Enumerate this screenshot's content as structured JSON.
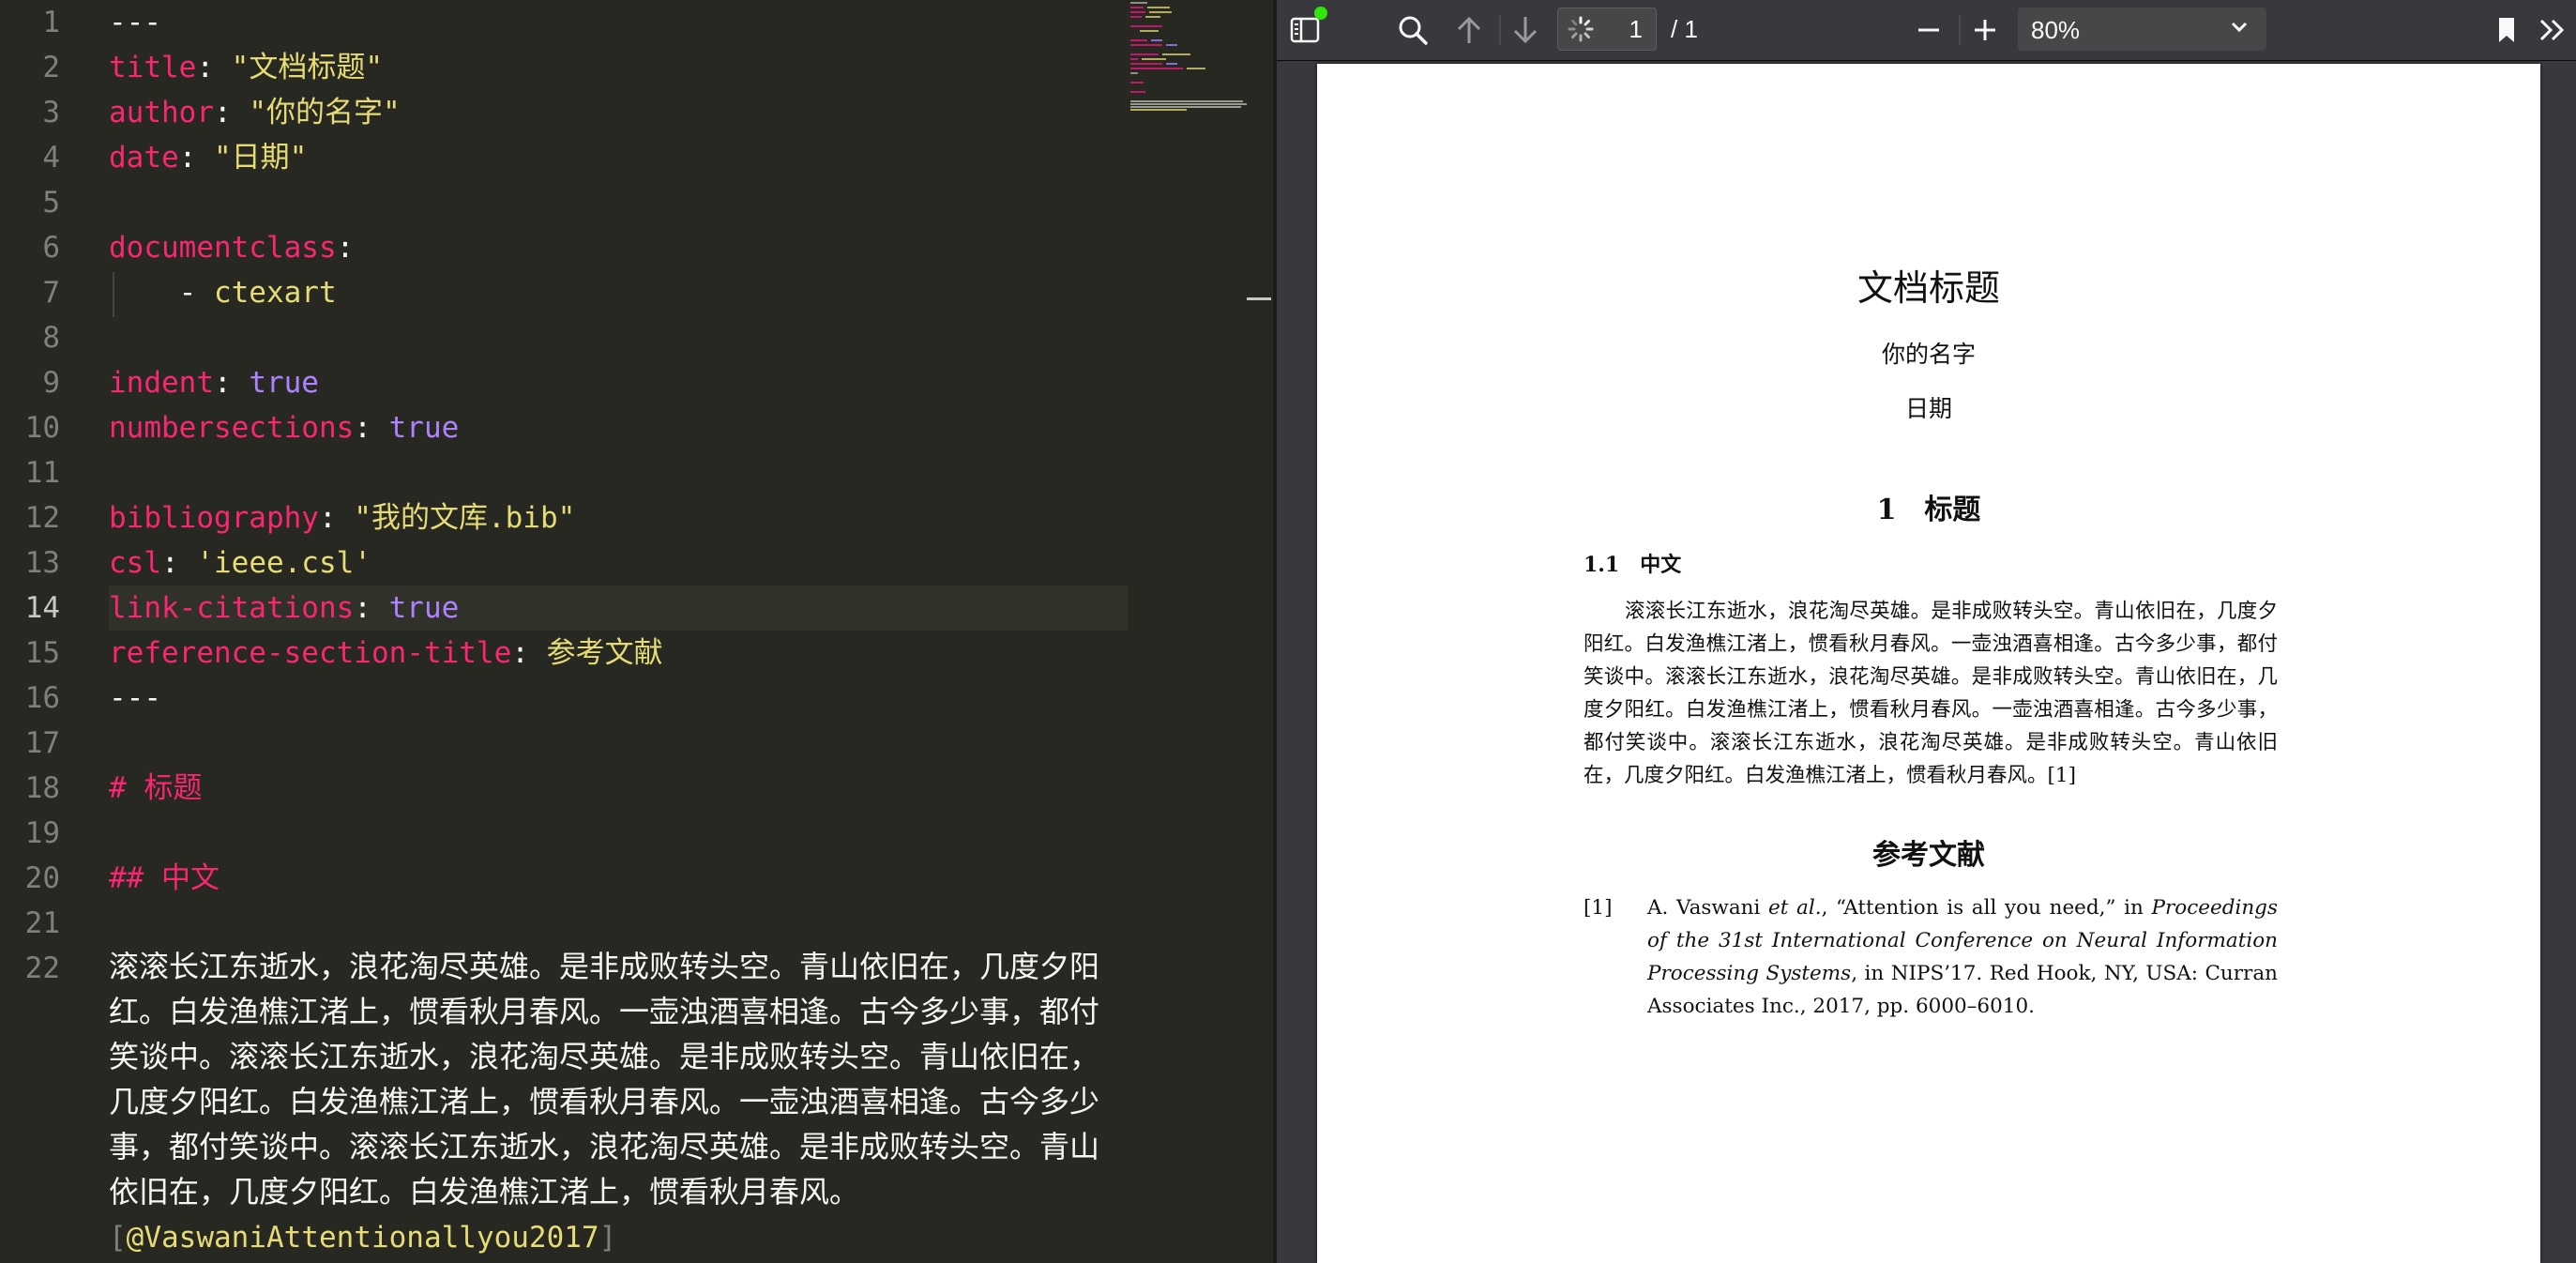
{
  "editor": {
    "lines": [
      {
        "n": "1",
        "tokens": [
          {
            "t": "---",
            "c": "p"
          }
        ]
      },
      {
        "n": "2",
        "tokens": [
          {
            "t": "title",
            "c": "k"
          },
          {
            "t": ": ",
            "c": "p"
          },
          {
            "t": "\"文档标题\"",
            "c": "s"
          }
        ]
      },
      {
        "n": "3",
        "tokens": [
          {
            "t": "author",
            "c": "k"
          },
          {
            "t": ": ",
            "c": "p"
          },
          {
            "t": "\"你的名字\"",
            "c": "s"
          }
        ]
      },
      {
        "n": "4",
        "tokens": [
          {
            "t": "date",
            "c": "k"
          },
          {
            "t": ": ",
            "c": "p"
          },
          {
            "t": "\"日期\"",
            "c": "s"
          }
        ]
      },
      {
        "n": "5",
        "tokens": []
      },
      {
        "n": "6",
        "tokens": [
          {
            "t": "documentclass",
            "c": "k"
          },
          {
            "t": ":",
            "c": "p"
          }
        ]
      },
      {
        "n": "7",
        "tokens": [
          {
            "t": "    - ",
            "c": "p"
          },
          {
            "t": "ctexart",
            "c": "s"
          }
        ]
      },
      {
        "n": "8",
        "tokens": []
      },
      {
        "n": "9",
        "tokens": [
          {
            "t": "indent",
            "c": "k"
          },
          {
            "t": ": ",
            "c": "p"
          },
          {
            "t": "true",
            "c": "b"
          }
        ]
      },
      {
        "n": "10",
        "tokens": [
          {
            "t": "numbersections",
            "c": "k"
          },
          {
            "t": ": ",
            "c": "p"
          },
          {
            "t": "true",
            "c": "b"
          }
        ]
      },
      {
        "n": "11",
        "tokens": []
      },
      {
        "n": "12",
        "tokens": [
          {
            "t": "bibliography",
            "c": "k"
          },
          {
            "t": ": ",
            "c": "p"
          },
          {
            "t": "\"我的文库.bib\"",
            "c": "s"
          }
        ]
      },
      {
        "n": "13",
        "tokens": [
          {
            "t": "csl",
            "c": "k"
          },
          {
            "t": ": ",
            "c": "p"
          },
          {
            "t": "'ieee.csl'",
            "c": "s"
          }
        ]
      },
      {
        "n": "14",
        "tokens": [
          {
            "t": "link-citations",
            "c": "k"
          },
          {
            "t": ": ",
            "c": "p"
          },
          {
            "t": "true",
            "c": "b"
          }
        ],
        "active": true
      },
      {
        "n": "15",
        "tokens": [
          {
            "t": "reference-section-title",
            "c": "k"
          },
          {
            "t": ": ",
            "c": "p"
          },
          {
            "t": "参考文献",
            "c": "s"
          }
        ]
      },
      {
        "n": "16",
        "tokens": [
          {
            "t": "---",
            "c": "p"
          }
        ]
      },
      {
        "n": "17",
        "tokens": []
      },
      {
        "n": "18",
        "tokens": [
          {
            "t": "# 标题",
            "c": "h"
          }
        ]
      },
      {
        "n": "19",
        "tokens": []
      },
      {
        "n": "20",
        "tokens": [
          {
            "t": "## 中文",
            "c": "h"
          }
        ]
      },
      {
        "n": "21",
        "tokens": []
      },
      {
        "n": "22",
        "tokens": []
      }
    ],
    "paragraph": "滚滚长江东逝水，浪花淘尽英雄。是非成败转头空。青山依旧在，几度夕阳红。白发渔樵江渚上，惯看秋月春风。一壶浊酒喜相逢。古今多少事，都付笑谈中。滚滚长江东逝水，浪花淘尽英雄。是非成败转头空。青山依旧在，几度夕阳红。白发渔樵江渚上，惯看秋月春风。一壶浊酒喜相逢。古今多少事，都付笑谈中。滚滚长江东逝水，浪花淘尽英雄。是非成败转头空。青山依旧在，几度夕阳红。白发渔樵江渚上，惯看秋月春风。",
    "cite_open": "[",
    "cite_key": "@VaswaniAttentionallyou2017",
    "cite_close": "]"
  },
  "toolbar": {
    "page_number": "1",
    "page_total": "/ 1",
    "zoom": "80%",
    "icons": [
      "sidebar-toggle-icon",
      "search-icon",
      "previous-page-icon",
      "next-page-icon",
      "loading-spinner-icon",
      "zoom-out-icon",
      "zoom-in-icon",
      "bookmark-icon",
      "tools-icon"
    ]
  },
  "pdf": {
    "title": "文档标题",
    "author": "你的名字",
    "date": "日期",
    "section": "1　标题",
    "subsection": "1.1　中文",
    "body": "滚滚长江东逝水，浪花淘尽英雄。是非成败转头空。青山依旧在，几度夕阳红。白发渔樵江渚上，惯看秋月春风。一壶浊酒喜相逢。古今多少事，都付笑谈中。滚滚长江东逝水，浪花淘尽英雄。是非成败转头空。青山依旧在，几度夕阳红。白发渔樵江渚上，惯看秋月春风。一壶浊酒喜相逢。古今多少事，都付笑谈中。滚滚长江东逝水，浪花淘尽英雄。是非成败转头空。青山依旧在，几度夕阳红。白发渔樵江渚上，惯看秋月春风。[1]",
    "references_title": "参考文献",
    "ref_num": "[1]",
    "ref_authors": "A. Vaswani ",
    "ref_etal": "et al.",
    "ref_title": ", “Attention is all you need,” in ",
    "ref_venue": "Proceedings of the 31st International Conference on Neural Information Processing Systems",
    "ref_rest": ", in NIPS’17. Red Hook, NY, USA: Curran Associates Inc., 2017, pp. 6000–6010."
  }
}
